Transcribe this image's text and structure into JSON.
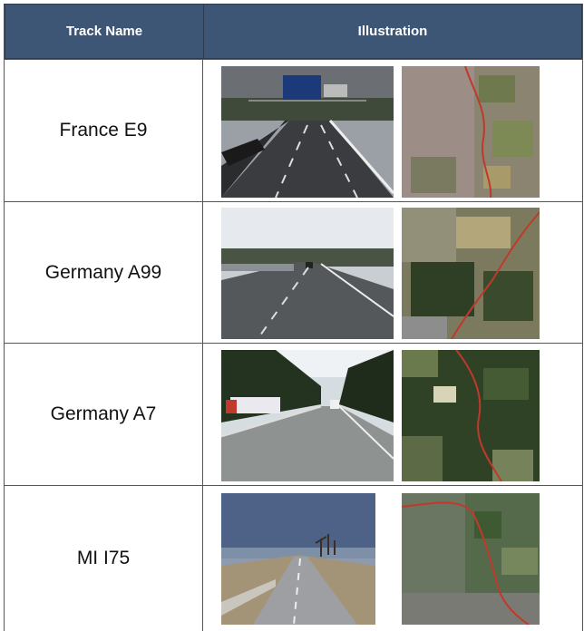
{
  "header": {
    "col_name": "Track Name",
    "col_illustration": "Illustration"
  },
  "rows": [
    {
      "name": "France E9",
      "photo_icon": "highway-photo",
      "map_icon": "satellite-map-route"
    },
    {
      "name": "Germany A99",
      "photo_icon": "highway-photo",
      "map_icon": "satellite-map-route"
    },
    {
      "name": "Germany A7",
      "photo_icon": "highway-photo",
      "map_icon": "satellite-map-route"
    },
    {
      "name": "MI I75",
      "photo_icon": "highway-photo",
      "map_icon": "satellite-map-route"
    }
  ],
  "colors": {
    "header_bg": "#3d5675",
    "route": "#c0392b"
  }
}
